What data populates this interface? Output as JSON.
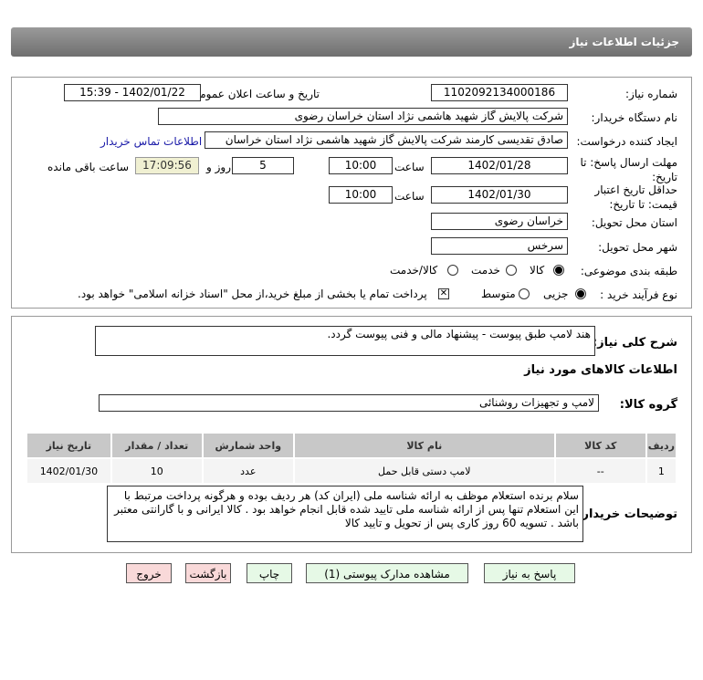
{
  "title": "جزئيات اطلاعات نیاز",
  "need_number": {
    "label": "شماره نیاز:",
    "value": "1102092134000186"
  },
  "announce": {
    "label": "تاریخ و ساعت اعلان عمومی:",
    "value": "1402/01/22 - 15:39"
  },
  "buyer": {
    "label": "نام دستگاه خریدار:",
    "value": "شرکت پالایش گاز شهید هاشمی نژاد   استان خراسان رضوی"
  },
  "creator": {
    "label": "ایجاد کننده درخواست:",
    "value": "صادق تقدیسی کارمند شرکت پالایش گاز شهید هاشمی نژاد   استان خراسان",
    "contact_link": "اطلاعات تماس خریدار"
  },
  "deadline": {
    "label": "مهلت ارسال پاسخ: تا تاریخ:",
    "date": "1402/01/28",
    "time_label": "ساعت",
    "time": "10:00",
    "days": "5",
    "days_label": "روز و",
    "remaining": "17:09:56",
    "remaining_label": "ساعت باقی مانده"
  },
  "validity": {
    "label": "حداقل تاریخ اعتبار قیمت: تا تاریخ:",
    "date": "1402/01/30",
    "time_label": "ساعت",
    "time": "10:00"
  },
  "province": {
    "label": "استان محل تحویل:",
    "value": "خراسان رضوی"
  },
  "city": {
    "label": "شهر محل تحویل:",
    "value": "سرخس"
  },
  "category": {
    "label": "طبقه بندی موضوعی:",
    "options": [
      "کالا",
      "خدمت",
      "کالا/خدمت"
    ],
    "selected": "کالا"
  },
  "process": {
    "label": "نوع فرآیند خرید :",
    "options": [
      "جزیی",
      "متوسط"
    ],
    "selected": "جزیی",
    "payment_note": "پرداخت تمام یا بخشی از مبلغ خرید،از محل \"اسناد خزانه اسلامی\" خواهد بود.",
    "payment_checked": true
  },
  "description": {
    "label": "شرح کلی نیاز:",
    "value": "هند لامپ  طبق پیوست - پیشنهاد مالی و فنی پیوست گردد."
  },
  "goods_header": "اطلاعات کالاهای مورد نیاز",
  "goods_group": {
    "label": "گروه کالا:",
    "value": "لامپ و تجهیزات روشنائی"
  },
  "table": {
    "headers": [
      "ردیف",
      "کد کالا",
      "نام کالا",
      "واحد شمارش",
      "تعداد / مقدار",
      "تاریخ نیاز"
    ],
    "rows": [
      [
        "1",
        "--",
        "لامپ دستی قابل حمل",
        "عدد",
        "10",
        "1402/01/30"
      ]
    ]
  },
  "buyer_notes": {
    "label": "توضیحات خریدار:",
    "value": "سلام  برنده استعلام موظف به ارائه شناسه ملی (ایران کد) هر ردیف بوده و هرگونه پرداخت مرتبط با این استعلام تنها پس از ارائه شناسه ملی تایید شده قابل انجام خواهد بود . کالا ایرانی و با گارانتی معتبر باشد . تسویه 60 روز کاری پس از تحویل و تایید کالا"
  },
  "buttons": {
    "reply": "پاسخ به نیاز",
    "attachments": "مشاهده مدارک پیوستی (1)",
    "print": "چاپ",
    "back": "بازگشت",
    "exit": "خروج"
  }
}
